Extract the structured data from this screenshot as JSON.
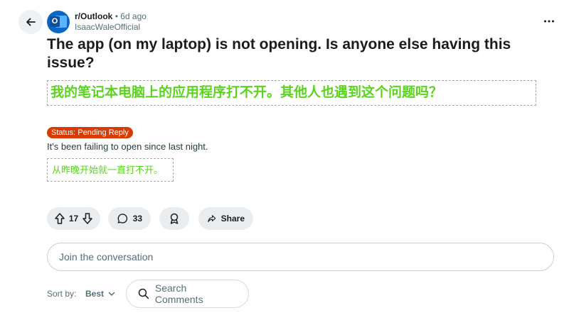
{
  "post": {
    "subreddit": "r/Outlook",
    "separator": "•",
    "time_ago": "6d ago",
    "author": "IsaacWaleOfficial",
    "icon_letter": "O",
    "title": "The app (on my laptop) is not opening. Is anyone else having this issue?",
    "title_translation": "我的笔记本电脑上的应用程序打不开。其他人也遇到这个问题吗？",
    "flair": "Status: Pending Reply",
    "body": "It's been failing to open since last night.",
    "body_translation": "从昨晚开始就一直打不开。"
  },
  "actions": {
    "vote_count": "17",
    "comment_count": "33",
    "share_label": "Share"
  },
  "comments": {
    "join_placeholder": "Join the conversation",
    "sort_label": "Sort by:",
    "sort_value": "Best",
    "search_placeholder": "Search Comments"
  },
  "colors": {
    "flair_bg": "#d93a00",
    "translation_text": "#5bd31f",
    "pill_bg": "#eaedef"
  },
  "icons": [
    "arrow-left-icon",
    "outlook-icon",
    "more-icon",
    "upvote-icon",
    "downvote-icon",
    "comment-icon",
    "award-icon",
    "share-icon",
    "chevron-down-icon",
    "search-icon"
  ]
}
